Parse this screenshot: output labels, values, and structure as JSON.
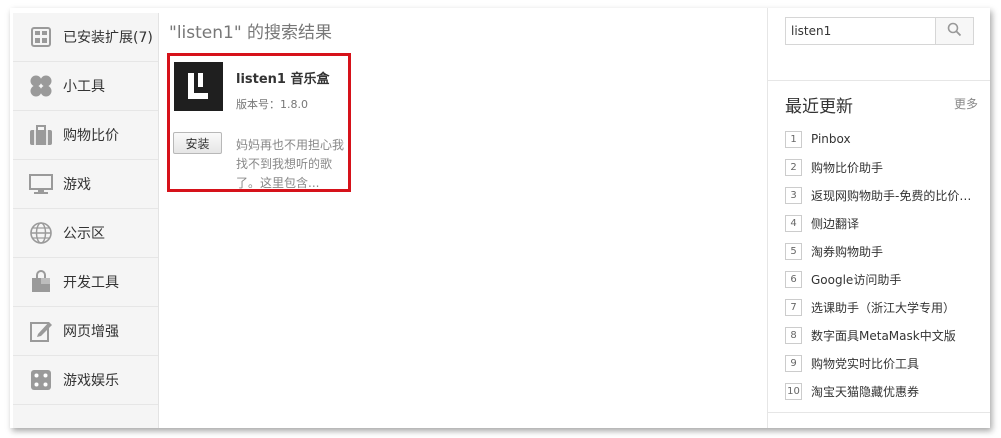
{
  "sidebar": {
    "items": [
      {
        "label": "已安装扩展(7)",
        "icon": "installed-grid-icon"
      },
      {
        "label": "小工具",
        "icon": "clover-icon"
      },
      {
        "label": "购物比价",
        "icon": "briefcase-icon"
      },
      {
        "label": "游戏",
        "icon": "monitor-icon"
      },
      {
        "label": "公示区",
        "icon": "globe-icon"
      },
      {
        "label": "开发工具",
        "icon": "shopping-bag-icon"
      },
      {
        "label": "网页增强",
        "icon": "edit-icon"
      },
      {
        "label": "游戏娱乐",
        "icon": "dice-icon"
      }
    ]
  },
  "main": {
    "result_title": "\"listen1\" 的搜索结果",
    "card": {
      "name": "listen1 音乐盒",
      "version": "版本号：1.8.0",
      "install_label": "安装",
      "description": "妈妈再也不用担心我找不到我想听的歌了。这里包含..."
    }
  },
  "right": {
    "search_value": "listen1",
    "recent_title": "最近更新",
    "more_label": "更多",
    "recent": [
      {
        "num": "1",
        "text": "Pinbox"
      },
      {
        "num": "2",
        "text": "购物比价助手"
      },
      {
        "num": "3",
        "text": "返现网购物助手-免费的比价…"
      },
      {
        "num": "4",
        "text": "侧边翻译"
      },
      {
        "num": "5",
        "text": "淘券购物助手"
      },
      {
        "num": "6",
        "text": "Google访问助手"
      },
      {
        "num": "7",
        "text": "选课助手（浙江大学专用）"
      },
      {
        "num": "8",
        "text": "数字面具MetaMask中文版"
      },
      {
        "num": "9",
        "text": "购物党实时比价工具"
      },
      {
        "num": "10",
        "text": "淘宝天猫隐藏优惠券"
      }
    ]
  },
  "colors": {
    "highlight_border": "#d6121a",
    "sidebar_bg": "#f5f5f5",
    "icon_gray": "#9a9a9a"
  }
}
